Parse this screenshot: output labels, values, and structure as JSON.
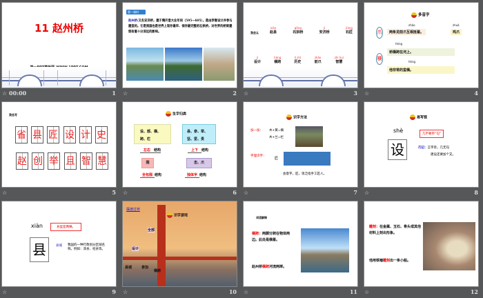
{
  "slides": [
    {
      "number": "1",
      "time": "00:00",
      "title": "11 赵州桥",
      "subtitle": "第一PPT模板网-WWW.1PPT.COM"
    },
    {
      "number": "2",
      "badge": "第一课时",
      "term": "赵州桥:",
      "text": "又名安济桥，建于隋开皇大业年间（595—605），是由李春设计并参与建造的。它是我国也是世界上现存最早、保存最完整的石拱桥，对世界的桥梁建筑有着十分深远的影响。"
    },
    {
      "number": "3",
      "label": "我会认",
      "row1": [
        {
          "py": "xiàn",
          "w": "赵县",
          "hl": "县"
        },
        {
          "py": "gǒng",
          "w": "石拱桥",
          "hl": "拱"
        },
        {
          "py": "jì",
          "w": "安济桥",
          "hl": "济"
        },
        {
          "py": "jiàng",
          "w": "石匠",
          "hl": "匠"
        }
      ],
      "row2": [
        {
          "py": "jì",
          "w": "设计",
          "hl": "计"
        },
        {
          "py": "héng",
          "w": "横跨",
          "hl": "横"
        },
        {
          "py": "lì shǐ",
          "w": "历史",
          "hl": "历史"
        },
        {
          "py": "zhǎo",
          "w": "前爪",
          "hl": "爪"
        },
        {
          "py": "zhì huì",
          "w": "智慧",
          "hl": "智慧"
        }
      ]
    },
    {
      "number": "4",
      "title": "多音字",
      "char1": "爪",
      "char2": "横",
      "s1_py": "zhǎo",
      "s1": "两条龙前爪互相抵着。",
      "s1b_py": "zhuǎ",
      "s1b": "鸡爪",
      "s2_py": "héng",
      "s2": "桥横跨在河上。",
      "s3_py": "hèng",
      "s3": "他非常的蛮横。"
    },
    {
      "number": "5",
      "label": "我会写",
      "chars": [
        "省",
        "县",
        "匠",
        "设",
        "计",
        "史",
        "赵",
        "创",
        "举",
        "且",
        "智",
        "慧"
      ]
    },
    {
      "number": "6",
      "title": "生字归类",
      "box1": "设、部、横、跨、栏",
      "box2": "县、参、举、坚、爱、贵",
      "box3": "围",
      "box4": "击、爪",
      "ans1": "左右",
      "ans2": "上下",
      "ans3": "全包围",
      "ans4": "独体字",
      "suffix": "结构"
    },
    {
      "number": "7",
      "title": "识字方法",
      "m1": "加一加：",
      "eq1": "木+黄=横",
      "eq2": "木+兰=栏",
      "m2": "字理识字：",
      "char": "匠",
      "caption": "会意字，匠，现泛指手工匠人。"
    },
    {
      "number": "8",
      "title": "易写错",
      "pinyin": "shè",
      "char": "设",
      "note": "几不要带“勾”",
      "tip_label": "巧记：",
      "tip": "言字旁，几无勾",
      "tip2": "建设还要加个又。"
    },
    {
      "number": "9",
      "pinyin": "xiàn",
      "char": "县",
      "note": "县里是两横。",
      "word": "县城",
      "def": "我国的一种行政划分区域名称。例如：涞县、杞县等。"
    },
    {
      "number": "10",
      "link": "摆渡过桥",
      "title": "识字游戏",
      "words": [
        "全部",
        "设计",
        "县城",
        "参加",
        "横跨"
      ]
    },
    {
      "number": "11",
      "label": "词语解释",
      "term": "横跨：",
      "def": "两脚分跨在物体两边。此处是横着。",
      "sentence_pre": "赵州桥",
      "sentence_hl": "横跨",
      "sentence_post": "河流两岸。"
    },
    {
      "number": "12",
      "term": "雕刻：",
      "def": "在金属、玉石、骨头或其他材料上刻出形象。",
      "sentence_pre": "他用铁锤",
      "sentence_hl": "雕刻",
      "sentence_post": "出一条小船。"
    }
  ]
}
